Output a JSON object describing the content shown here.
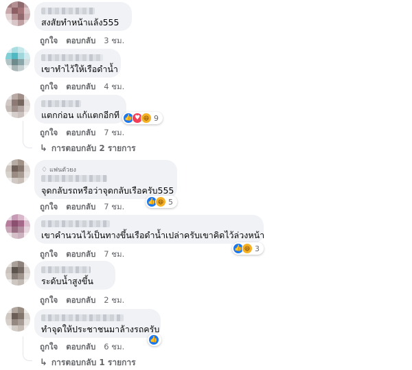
{
  "actions": {
    "like": "ถูกใจ",
    "reply": "ตอบกลับ"
  },
  "comments": [
    {
      "text": "สงสัยทำหน้าแล้ง555",
      "time": "3 ชม."
    },
    {
      "text": "เขาทำไว้ให้เรือดำน้ำ",
      "time": "4 ชม."
    },
    {
      "text": "แตกก่อน แก้แตกอีกที",
      "time": "7 ชม.",
      "reactions": [
        "like",
        "love",
        "haha"
      ],
      "reaction_count": "9",
      "replies": "การตอบกลับ 2 รายการ"
    },
    {
      "badge": "แฟนตัวยง",
      "text": "จุดกลับรถหรือว่าจุดกลับเรือครับ555",
      "time": "7 ชม.",
      "reactions": [
        "like",
        "haha"
      ],
      "reaction_count": "5"
    },
    {
      "text": "เขาคำนวนไว้เป็นทางขึ้นเรือดำน้ำเปล่าครับเขาคิดไว้ล่วงหน้า",
      "time": "7 ชม.",
      "reactions": [
        "like",
        "haha"
      ],
      "reaction_count": "3"
    },
    {
      "text": "ระดับน้ำสูงขึ้น",
      "time": "2 ชม."
    },
    {
      "text": "ทำจุดให้ประชาชนมาล้างรถครับ",
      "time": "6 ชม.",
      "reactions": [
        "like"
      ],
      "replies": "การตอบกลับ 1 รายการ"
    }
  ]
}
